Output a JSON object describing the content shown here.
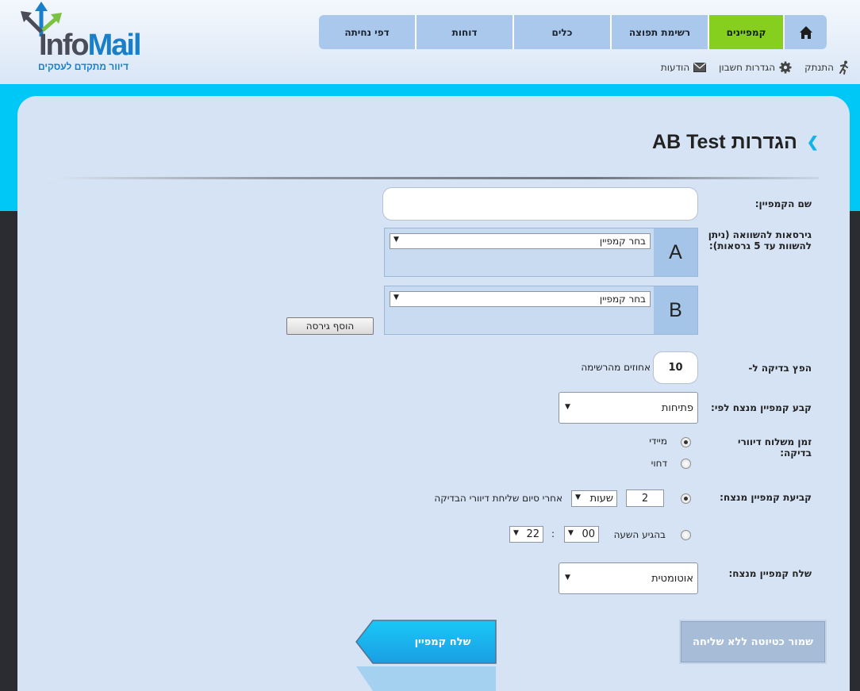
{
  "brand": {
    "word_part1": "Info",
    "word_part2": "Mail",
    "tagline": "דיוור מתקדם לעסקים"
  },
  "nav": {
    "tabs": [
      {
        "label": "קמפיינים",
        "active": true
      },
      {
        "label": "רשימת תפוצה"
      },
      {
        "label": "כלים"
      },
      {
        "label": "דוחות"
      },
      {
        "label": "דפי נחיתה"
      }
    ]
  },
  "utility": {
    "messages": "הודעות",
    "account_settings": "הגדרות חשבון",
    "logout": "התנתק"
  },
  "page": {
    "title": "הגדרות AB Test"
  },
  "form": {
    "campaign_name_label": "שם הקמפיין:",
    "campaign_name_value": "",
    "versions_label": "גירסאות להשוואה (ניתן להשוות עד 5 גרסאות):",
    "versions": [
      {
        "letter": "A",
        "selected": "בחר קמפיין"
      },
      {
        "letter": "B",
        "selected": "בחר קמפיין"
      }
    ],
    "add_version_button": "הוסף גירסה",
    "distribute_label": "הפץ בדיקה ל-",
    "distribute_value": "10",
    "distribute_suffix": "אחוזים מהרשימה",
    "winner_by_label": "קבע קמפיין מנצח לפי:",
    "winner_by_value": "פתיחות",
    "send_time_label": "זמן משלוח דיוורי בדיקה:",
    "send_time_options": {
      "immediate": "מיידי",
      "delayed": "דחוי"
    },
    "winner_timing_label": "קביעת קמפיין מנצח:",
    "winner_after_value": "2",
    "winner_after_unit": "שעות",
    "winner_after_text": "אחרי סיום שליחת דיוורי הבדיקה",
    "winner_at_text": "בהגיע השעה",
    "winner_at_minutes": "00",
    "winner_at_separator": ":",
    "winner_at_hours": "22",
    "send_winner_label": "שלח קמפיין מנצח:",
    "send_winner_value": "אוטומטית"
  },
  "buttons": {
    "save_draft": "שמור כטיוטה ללא שליחה",
    "send_campaign": "שלח קמפיין"
  },
  "colors": {
    "accent_cyan": "#00c8f6",
    "active_tab": "#86cf1f",
    "tab": "#a9c8ec",
    "panel": "#d5e3f5",
    "brand_blue": "#1a7fc9"
  }
}
